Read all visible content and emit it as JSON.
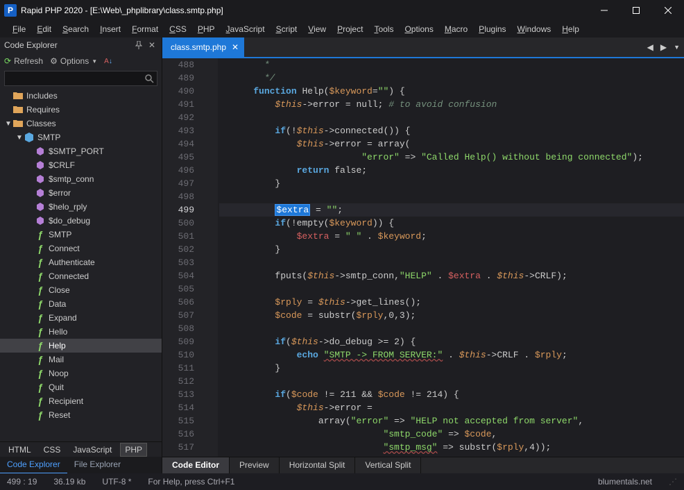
{
  "app": {
    "icon": "P",
    "title": "Rapid PHP 2020 - [E:\\Web\\_phplibrary\\class.smtp.php]"
  },
  "menu": [
    "File",
    "Edit",
    "Search",
    "Insert",
    "Format",
    "CSS",
    "PHP",
    "JavaScript",
    "Script",
    "View",
    "Project",
    "Tools",
    "Options",
    "Macro",
    "Plugins",
    "Windows",
    "Help"
  ],
  "explorer": {
    "title": "Code Explorer",
    "refresh": "Refresh",
    "options": "Options",
    "tree": {
      "includes": "Includes",
      "requires": "Requires",
      "classes": "Classes",
      "smtp": "SMTP",
      "vars": [
        "$SMTP_PORT",
        "$CRLF",
        "$smtp_conn",
        "$error",
        "$helo_rply",
        "$do_debug"
      ],
      "fns": [
        "SMTP",
        "Connect",
        "Authenticate",
        "Connected",
        "Close",
        "Data",
        "Expand",
        "Hello",
        "Help",
        "Mail",
        "Noop",
        "Quit",
        "Recipient",
        "Reset"
      ]
    },
    "langTabs": [
      "HTML",
      "CSS",
      "JavaScript",
      "PHP"
    ],
    "panelTabs": [
      "Code Explorer",
      "File Explorer"
    ]
  },
  "fileTab": "class.smtp.php",
  "code": [
    {
      "n": 488,
      "ind": 3,
      "t": [
        [
          "c",
          "*"
        ]
      ]
    },
    {
      "n": 489,
      "ind": 3,
      "t": [
        [
          "c",
          "*/"
        ]
      ]
    },
    {
      "n": 490,
      "ind": 2,
      "t": [
        [
          "k",
          "function"
        ],
        [
          "",
          ""
        ],
        [
          "id",
          " Help("
        ],
        [
          "v",
          "$keyword"
        ],
        [
          "op",
          "="
        ],
        [
          "s",
          "\"\""
        ],
        [
          "id",
          ") "
        ],
        [
          "op",
          "{"
        ]
      ]
    },
    {
      "n": 491,
      "ind": 4,
      "t": [
        [
          "this",
          "$this"
        ],
        [
          "op",
          "->"
        ],
        [
          "id",
          "error = null; "
        ],
        [
          "c",
          "# to avoid confusion"
        ]
      ]
    },
    {
      "n": 492,
      "ind": 0,
      "t": []
    },
    {
      "n": 493,
      "ind": 4,
      "t": [
        [
          "k",
          "if"
        ],
        [
          "op",
          "(!"
        ],
        [
          "this",
          "$this"
        ],
        [
          "op",
          "->"
        ],
        [
          "id",
          "connected()) "
        ],
        [
          "op",
          "{"
        ]
      ]
    },
    {
      "n": 494,
      "ind": 6,
      "t": [
        [
          "this",
          "$this"
        ],
        [
          "op",
          "->"
        ],
        [
          "id",
          "error = "
        ],
        [
          "id",
          "array("
        ]
      ]
    },
    {
      "n": 495,
      "ind": 12,
      "t": [
        [
          "s",
          "\"error\""
        ],
        [
          "op",
          " => "
        ],
        [
          "s",
          "\"Called Help() without being connected\""
        ],
        [
          "op",
          ");"
        ]
      ]
    },
    {
      "n": 496,
      "ind": 6,
      "t": [
        [
          "k",
          "return"
        ],
        [
          "id",
          " false;"
        ]
      ]
    },
    {
      "n": 497,
      "ind": 4,
      "t": [
        [
          "op",
          "}"
        ]
      ]
    },
    {
      "n": 498,
      "ind": 0,
      "t": []
    },
    {
      "n": 499,
      "cur": true,
      "ind": 4,
      "t": [
        [
          "sel",
          "$extra"
        ],
        [
          "op",
          " = "
        ],
        [
          "s",
          "\"\""
        ],
        [
          "op",
          ";"
        ]
      ]
    },
    {
      "n": 500,
      "ind": 4,
      "t": [
        [
          "k",
          "if"
        ],
        [
          "op",
          "(!"
        ],
        [
          "id",
          "empty("
        ],
        [
          "v",
          "$keyword"
        ],
        [
          "id",
          ")) "
        ],
        [
          "op",
          "{"
        ]
      ]
    },
    {
      "n": 501,
      "ind": 6,
      "t": [
        [
          "ve",
          "$extra"
        ],
        [
          "op",
          " = "
        ],
        [
          "s",
          "\" \""
        ],
        [
          "op",
          " . "
        ],
        [
          "v",
          "$keyword"
        ],
        [
          "op",
          ";"
        ]
      ]
    },
    {
      "n": 502,
      "ind": 4,
      "t": [
        [
          "op",
          "}"
        ]
      ]
    },
    {
      "n": 503,
      "ind": 0,
      "t": []
    },
    {
      "n": 504,
      "ind": 4,
      "t": [
        [
          "id",
          "fputs("
        ],
        [
          "this",
          "$this"
        ],
        [
          "op",
          "->"
        ],
        [
          "id",
          "smtp_conn,"
        ],
        [
          "s",
          "\"HELP\""
        ],
        [
          "op",
          " . "
        ],
        [
          "ve",
          "$extra"
        ],
        [
          "op",
          " . "
        ],
        [
          "this",
          "$this"
        ],
        [
          "op",
          "->"
        ],
        [
          "id",
          "CRLF);"
        ]
      ]
    },
    {
      "n": 505,
      "ind": 0,
      "t": []
    },
    {
      "n": 506,
      "ind": 4,
      "t": [
        [
          "v",
          "$rply"
        ],
        [
          "op",
          " = "
        ],
        [
          "this",
          "$this"
        ],
        [
          "op",
          "->"
        ],
        [
          "id",
          "get_lines();"
        ]
      ]
    },
    {
      "n": 507,
      "ind": 4,
      "t": [
        [
          "v",
          "$code"
        ],
        [
          "op",
          " = "
        ],
        [
          "id",
          "substr("
        ],
        [
          "v",
          "$rply"
        ],
        [
          "op",
          ","
        ],
        [
          "id",
          "0"
        ],
        [
          "op",
          ","
        ],
        [
          "id",
          "3);"
        ]
      ]
    },
    {
      "n": 508,
      "ind": 0,
      "t": []
    },
    {
      "n": 509,
      "ind": 4,
      "t": [
        [
          "k",
          "if"
        ],
        [
          "op",
          "("
        ],
        [
          "this",
          "$this"
        ],
        [
          "op",
          "->"
        ],
        [
          "id",
          "do_debug >= 2) "
        ],
        [
          "op",
          "{"
        ]
      ]
    },
    {
      "n": 510,
      "ind": 6,
      "t": [
        [
          "k",
          "echo"
        ],
        [
          "op",
          " "
        ],
        [
          "sq",
          "\"SMTP -> FROM SERVER:\""
        ],
        [
          "op",
          " . "
        ],
        [
          "this",
          "$this"
        ],
        [
          "op",
          "->"
        ],
        [
          "id",
          "CRLF . "
        ],
        [
          "v",
          "$rply"
        ],
        [
          "op",
          ";"
        ]
      ]
    },
    {
      "n": 511,
      "ind": 4,
      "t": [
        [
          "op",
          "}"
        ]
      ]
    },
    {
      "n": 512,
      "ind": 0,
      "t": []
    },
    {
      "n": 513,
      "ind": 4,
      "t": [
        [
          "k",
          "if"
        ],
        [
          "op",
          "("
        ],
        [
          "v",
          "$code"
        ],
        [
          "op",
          " != 211 && "
        ],
        [
          "v",
          "$code"
        ],
        [
          "op",
          " != 214) "
        ],
        [
          "op",
          "{"
        ]
      ]
    },
    {
      "n": 514,
      "ind": 6,
      "t": [
        [
          "this",
          "$this"
        ],
        [
          "op",
          "->"
        ],
        [
          "id",
          "error ="
        ]
      ]
    },
    {
      "n": 515,
      "ind": 8,
      "t": [
        [
          "id",
          "array("
        ],
        [
          "s",
          "\"error\""
        ],
        [
          "op",
          " => "
        ],
        [
          "s",
          "\"HELP not accepted from server\""
        ],
        [
          "op",
          ","
        ]
      ]
    },
    {
      "n": 516,
      "ind": 14,
      "t": [
        [
          "s",
          "\"smtp_code\""
        ],
        [
          "op",
          " => "
        ],
        [
          "v",
          "$code"
        ],
        [
          "op",
          ","
        ]
      ]
    },
    {
      "n": 517,
      "ind": 14,
      "t": [
        [
          "sq",
          "\"smtp_msg\""
        ],
        [
          "op",
          " => "
        ],
        [
          "id",
          "substr("
        ],
        [
          "v",
          "$rply"
        ],
        [
          "op",
          ",4));"
        ]
      ]
    }
  ],
  "editorTabs": [
    "Code Editor",
    "Preview",
    "Horizontal Split",
    "Vertical Split"
  ],
  "status": {
    "pos": "499 : 19",
    "size": "36.19 kb",
    "enc": "UTF-8 *",
    "hint": "For Help, press Ctrl+F1",
    "brand": "blumentals.net"
  }
}
